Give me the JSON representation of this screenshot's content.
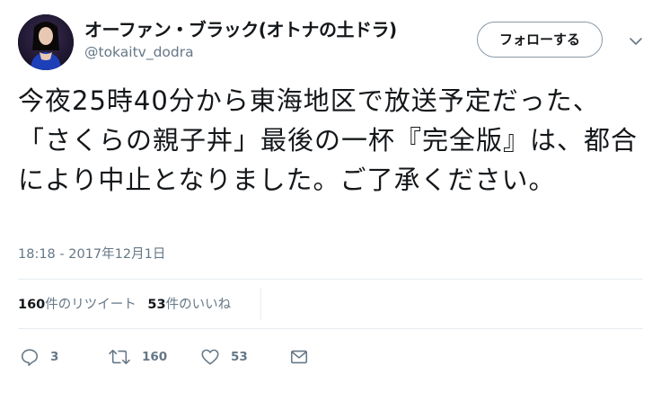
{
  "author": {
    "display_name": "オーファン・ブラック(オトナの土ドラ)",
    "handle": "@tokaitv_dodra",
    "avatar_icon": "profile-photo"
  },
  "follow_button": {
    "label": "フォローする"
  },
  "tweet": {
    "text": "今夜25時40分から東海地区で放送予定だった、「さくらの親子丼」最後の一杯『完全版』は、都合により中止となりました。ご了承ください。",
    "timestamp": "18:18 - 2017年12月1日"
  },
  "stats": {
    "retweets_count": "160",
    "retweets_label": "件のリツイート",
    "likes_count": "53",
    "likes_label": "件のいいね"
  },
  "actions": {
    "reply_count": "3",
    "retweet_count": "160",
    "like_count": "53"
  },
  "colors": {
    "text_primary": "#14171a",
    "text_secondary": "#657786",
    "divider": "#e6ecf0"
  }
}
